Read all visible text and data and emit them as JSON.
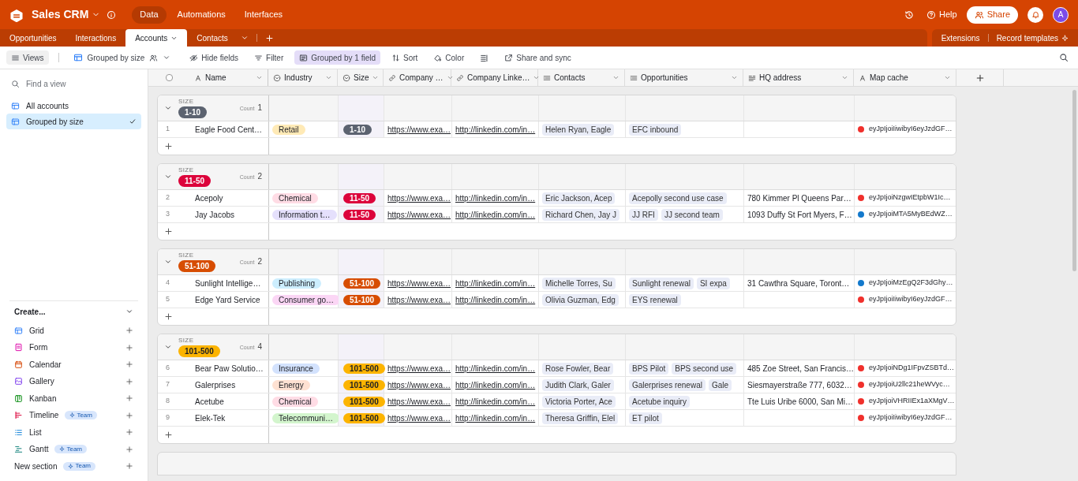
{
  "app": {
    "title": "Sales CRM",
    "nav": [
      {
        "label": "Data",
        "selected": true
      },
      {
        "label": "Automations",
        "selected": false
      },
      {
        "label": "Interfaces",
        "selected": false
      }
    ],
    "help": "Help",
    "share": "Share",
    "avatar": "A"
  },
  "tables": [
    {
      "label": "Opportunities",
      "selected": false
    },
    {
      "label": "Interactions",
      "selected": false
    },
    {
      "label": "Accounts",
      "selected": true
    },
    {
      "label": "Contacts",
      "selected": false
    }
  ],
  "table_tools": [
    "Extensions",
    "Record templates"
  ],
  "toolbar": {
    "views": "Views",
    "view_name": "Grouped by size",
    "items": [
      {
        "kind": "hide",
        "label": "Hide fields",
        "active": false
      },
      {
        "kind": "filter",
        "label": "Filter",
        "active": false
      },
      {
        "kind": "group",
        "label": "Grouped by 1 field",
        "active": true
      },
      {
        "kind": "sort",
        "label": "Sort",
        "active": false
      },
      {
        "kind": "color",
        "label": "Color",
        "active": false
      },
      {
        "kind": "rowheight",
        "active": false
      },
      {
        "kind": "share",
        "label": "Share and sync",
        "active": false
      }
    ]
  },
  "sidebar": {
    "search_placeholder": "Find a view",
    "views": [
      {
        "label": "All accounts",
        "selected": false
      },
      {
        "label": "Grouped by size",
        "selected": true
      }
    ],
    "create_label": "Create...",
    "create_items": [
      {
        "kind": "grid",
        "label": "Grid"
      },
      {
        "kind": "form",
        "label": "Form"
      },
      {
        "kind": "calendar",
        "label": "Calendar"
      },
      {
        "kind": "gallery",
        "label": "Gallery"
      },
      {
        "kind": "kanban",
        "label": "Kanban"
      },
      {
        "kind": "timeline",
        "label": "Timeline",
        "badge": "Team"
      },
      {
        "kind": "list",
        "label": "List"
      },
      {
        "kind": "gantt",
        "label": "Gantt",
        "badge": "Team"
      },
      {
        "kind": "section",
        "label": "New section",
        "badge": "Team"
      }
    ]
  },
  "table": {
    "select_all": {
      "checked": false
    },
    "columns": [
      {
        "kind": "text",
        "label": "Name"
      },
      {
        "kind": "select",
        "label": "Industry"
      },
      {
        "kind": "select",
        "label": "Size"
      },
      {
        "kind": "link",
        "label": "Company …"
      },
      {
        "kind": "link",
        "label": "Company Linke…"
      },
      {
        "kind": "linked",
        "label": "Contacts"
      },
      {
        "kind": "linked",
        "label": "Opportunities"
      },
      {
        "kind": "longtext",
        "label": "HQ address"
      },
      {
        "kind": "text",
        "label": "Map cache"
      }
    ],
    "groups": [
      {
        "field": "SIZE",
        "value": "1-10",
        "color": "#5c6370",
        "count_label": "Count",
        "count": "1",
        "rows": [
          {
            "num": "1",
            "name": "Eagle Food Cent…",
            "industry": {
              "label": "Retail",
              "color": "#ffeab6"
            },
            "size": {
              "label": "1-10",
              "color": "#5c6370"
            },
            "website": "https://www.exa…",
            "linkedin": "http://linkedin.com/in…",
            "contacts": [
              "Helen Ryan, Eagle"
            ],
            "opportunities": [
              "EFC inbound"
            ],
            "hq": "",
            "map": {
              "color": "#f0302c",
              "text": "eyJpIjoiIiwibyI6eyJzdGF…"
            }
          }
        ]
      },
      {
        "field": "SIZE",
        "value": "11-50",
        "color": "#dc043b",
        "count_label": "Count",
        "count": "2",
        "rows": [
          {
            "num": "2",
            "name": "Acepoly",
            "industry": {
              "label": "Chemical",
              "color": "#ffdce5"
            },
            "size": {
              "label": "11-50",
              "color": "#dc043b"
            },
            "website": "https://www.exa…",
            "linkedin": "http://linkedin.com/in…",
            "contacts": [
              "Eric Jackson, Acep"
            ],
            "opportunities": [
              "Acepolly second use case"
            ],
            "hq": "780 Kimmer Pl Queens Par…",
            "map": {
              "color": "#f0302c",
              "text": "eyJpIjoiNzgwIEtpbW1Ic…"
            }
          },
          {
            "num": "3",
            "name": "Jay Jacobs",
            "industry": {
              "label": "Information t…",
              "color": "#e5e0fc"
            },
            "size": {
              "label": "11-50",
              "color": "#dc043b"
            },
            "website": "https://www.exa…",
            "linkedin": "http://linkedin.com/in…",
            "contacts": [
              "Richard Chen, Jay J"
            ],
            "opportunities": [
              "JJ RFI",
              "JJ second team"
            ],
            "hq": "1093 Duffy St Fort Myers, F…",
            "map": {
              "color": "#1379cc",
              "text": "eyJpIjoiMTA5MyBEdWZ…"
            }
          }
        ]
      },
      {
        "field": "SIZE",
        "value": "51-100",
        "color": "#d74d02",
        "count_label": "Count",
        "count": "2",
        "rows": [
          {
            "num": "4",
            "name": "Sunlight Intellige…",
            "industry": {
              "label": "Publishing",
              "color": "#cdeefe"
            },
            "size": {
              "label": "51-100",
              "color": "#d74d02"
            },
            "website": "https://www.exa…",
            "linkedin": "http://linkedin.com/in…",
            "contacts": [
              "Michelle Torres, Su"
            ],
            "opportunities": [
              "Sunlight renewal",
              "SI expa"
            ],
            "hq": "31 Cawthra Square, Toront…",
            "map": {
              "color": "#1379cc",
              "text": "eyJpIjoiMzEgQ2F3dGhy…"
            }
          },
          {
            "num": "5",
            "name": "Edge Yard Service",
            "industry": {
              "label": "Consumer go…",
              "color": "#fbd6f5"
            },
            "size": {
              "label": "51-100",
              "color": "#d74d02"
            },
            "website": "https://www.exa…",
            "linkedin": "http://linkedin.com/in…",
            "contacts": [
              "Olivia Guzman, Edg"
            ],
            "opportunities": [
              "EYS renewal"
            ],
            "hq": "",
            "map": {
              "color": "#f0302c",
              "text": "eyJpIjoiIiwibyI6eyJzdGF…"
            }
          }
        ]
      },
      {
        "field": "SIZE",
        "value": "101-500",
        "color": "#fcb400",
        "count_label": "Count",
        "count": "4",
        "rows": [
          {
            "num": "6",
            "name": "Bear Paw Solutio…",
            "industry": {
              "label": "Insurance",
              "color": "#d3e2fd"
            },
            "size": {
              "label": "101-500",
              "color": "#fcb400"
            },
            "website": "https://www.exa…",
            "linkedin": "http://linkedin.com/in…",
            "contacts": [
              "Rose Fowler, Bear"
            ],
            "opportunities": [
              "BPS Pilot",
              "BPS second use"
            ],
            "hq": "485 Zoe Street, San Francis…",
            "map": {
              "color": "#f0302c",
              "text": "eyJpIjoiNDg1IFpvZSBTd…"
            }
          },
          {
            "num": "7",
            "name": "Galerprises",
            "industry": {
              "label": "Energy",
              "color": "#fee1d2"
            },
            "size": {
              "label": "101-500",
              "color": "#fcb400"
            },
            "website": "https://www.exa…",
            "linkedin": "http://linkedin.com/in…",
            "contacts": [
              "Judith Clark, Galer"
            ],
            "opportunities": [
              "Galerprises renewal",
              "Gale"
            ],
            "hq": "Siesmayerstraße 777, 6032…",
            "map": {
              "color": "#f0302c",
              "text": "eyJpIjoiU2llc21heWVyc…"
            }
          },
          {
            "num": "8",
            "name": "Acetube",
            "industry": {
              "label": "Chemical",
              "color": "#ffdce5"
            },
            "size": {
              "label": "101-500",
              "color": "#fcb400"
            },
            "website": "https://www.exa…",
            "linkedin": "http://linkedin.com/in…",
            "contacts": [
              "Victoria Porter, Ace"
            ],
            "opportunities": [
              "Acetube inquiry"
            ],
            "hq": "Tte Luis Uribe 6000, San Mi…",
            "map": {
              "color": "#f0302c",
              "text": "eyJpIjoiVHRIIEx1aXMgV…"
            }
          },
          {
            "num": "9",
            "name": "Elek-Tek",
            "industry": {
              "label": "Telecommuni…",
              "color": "#d3f5cd"
            },
            "size": {
              "label": "101-500",
              "color": "#fcb400"
            },
            "website": "https://www.exa…",
            "linkedin": "http://linkedin.com/in…",
            "contacts": [
              "Theresa Griffin, Elel"
            ],
            "opportunities": [
              "ET pilot"
            ],
            "hq": "",
            "map": {
              "color": "#f0302c",
              "text": "eyJpIjoiIiwibyI6eyJzdGF…"
            }
          }
        ]
      }
    ]
  }
}
